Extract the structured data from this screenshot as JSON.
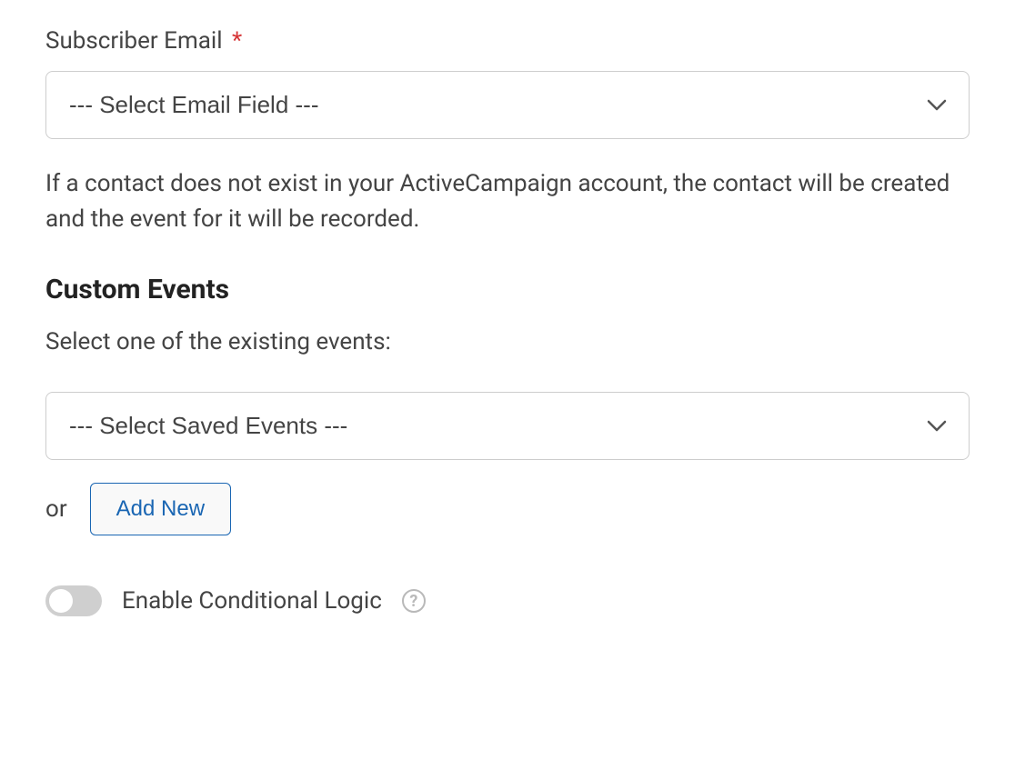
{
  "subscriber_email": {
    "label": "Subscriber Email",
    "required_mark": "*",
    "select_placeholder": "--- Select Email Field ---"
  },
  "helper_text": "If a contact does not exist in your ActiveCampaign account, the contact will be created and the event for it will be recorded.",
  "custom_events": {
    "heading": "Custom Events",
    "sub_label": "Select one of the existing events:",
    "select_placeholder": "--- Select Saved Events ---",
    "or_text": "or",
    "add_new_label": "Add New"
  },
  "conditional_logic": {
    "label": "Enable Conditional Logic",
    "help_char": "?"
  }
}
